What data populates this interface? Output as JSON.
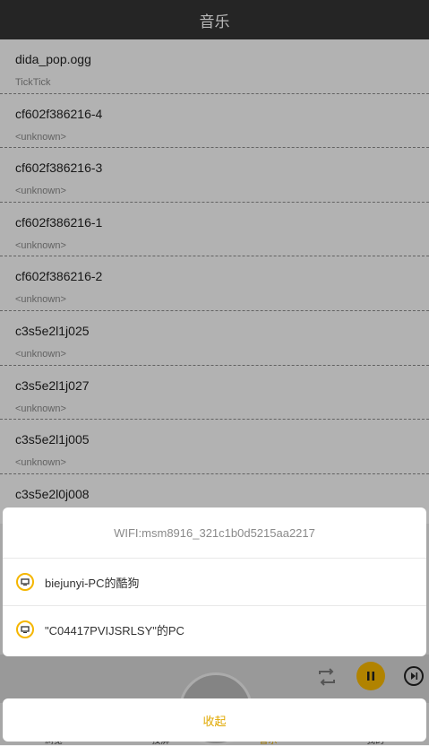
{
  "header": {
    "title": "音乐"
  },
  "songs": [
    {
      "name": "dida_pop.ogg",
      "artist": "TickTick"
    },
    {
      "name": "cf602f386216-4",
      "artist": "<unknown>"
    },
    {
      "name": "cf602f386216-3",
      "artist": "<unknown>"
    },
    {
      "name": "cf602f386216-1",
      "artist": "<unknown>"
    },
    {
      "name": "cf602f386216-2",
      "artist": "<unknown>"
    },
    {
      "name": "c3s5e2l1j025",
      "artist": "<unknown>"
    },
    {
      "name": "c3s5e2l1j027",
      "artist": "<unknown>"
    },
    {
      "name": "c3s5e2l1j005",
      "artist": "<unknown>"
    },
    {
      "name": "c3s5e2l0j008",
      "artist": ""
    }
  ],
  "bottom_tabs": [
    "浏览",
    "投屏",
    "音乐",
    "我的"
  ],
  "sheet": {
    "wifi_label": "WIFI:msm8916_321c1b0d5215aa2217",
    "devices": [
      "biejunyi-PC的酷狗",
      "\"C04417PVIJSRLSY\"的PC"
    ]
  },
  "collapse_label": "收起",
  "colors": {
    "accent": "#f5b600",
    "titlebar": "#343434"
  }
}
